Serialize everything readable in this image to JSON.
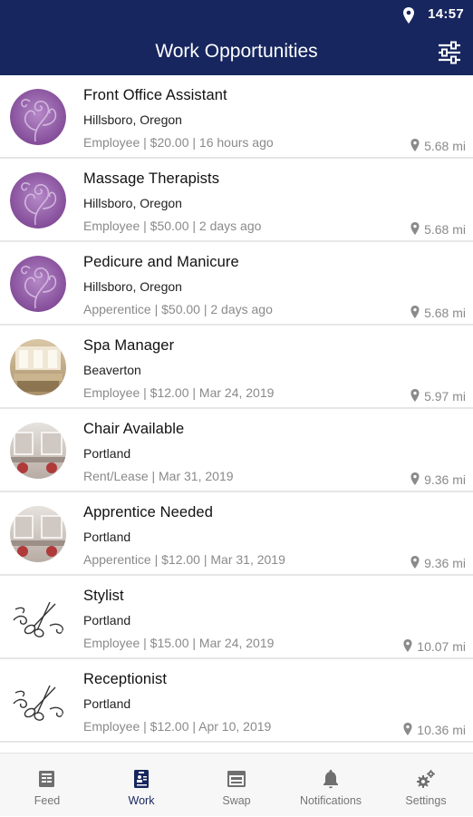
{
  "status_bar": {
    "time": "14:57",
    "location_icon": "location-pin-icon"
  },
  "header": {
    "title": "Work Opportunities",
    "filter_icon": "filter-sliders-icon"
  },
  "colors": {
    "primary": "#17265e",
    "muted": "#8a8a8a",
    "divider": "#e6e6e6",
    "purple_avatar": "#8f5aa6"
  },
  "jobs": [
    {
      "title": "Front Office Assistant",
      "location": "Hillsboro, Oregon",
      "meta": "Employee | $20.00 | 16 hours ago",
      "distance": "5.68 mi",
      "avatar": "purple-swirl"
    },
    {
      "title": "Massage Therapists",
      "location": "Hillsboro, Oregon",
      "meta": "Employee | $50.00 | 2 days ago",
      "distance": "5.68 mi",
      "avatar": "purple-swirl"
    },
    {
      "title": "Pedicure and Manicure",
      "location": "Hillsboro, Oregon",
      "meta": "Apperentice | $50.00 | 2 days ago",
      "distance": "5.68 mi",
      "avatar": "purple-swirl"
    },
    {
      "title": "Spa Manager",
      "location": "Beaverton",
      "meta": "Employee | $12.00 | Mar 24, 2019",
      "distance": "5.97 mi",
      "avatar": "spa-photo"
    },
    {
      "title": "Chair Available",
      "location": "Portland",
      "meta": "Rent/Lease | Mar 31, 2019",
      "distance": "9.36 mi",
      "avatar": "salon-photo"
    },
    {
      "title": "Apprentice Needed",
      "location": "Portland",
      "meta": "Apperentice | $12.00 | Mar 31, 2019",
      "distance": "9.36 mi",
      "avatar": "salon-photo"
    },
    {
      "title": "Stylist",
      "location": "Portland",
      "meta": "Employee | $15.00 | Mar 24, 2019",
      "distance": "10.07 mi",
      "avatar": "scissors-sketch"
    },
    {
      "title": "Receptionist",
      "location": "Portland",
      "meta": "Employee | $12.00 | Apr 10, 2019",
      "distance": "10.36 mi",
      "avatar": "scissors-sketch"
    }
  ],
  "bottom_nav": [
    {
      "label": "Feed",
      "icon": "feed-icon",
      "active": false
    },
    {
      "label": "Work",
      "icon": "work-badge-icon",
      "active": true
    },
    {
      "label": "Swap",
      "icon": "swap-icon",
      "active": false
    },
    {
      "label": "Notifications",
      "icon": "bell-icon",
      "active": false
    },
    {
      "label": "Settings",
      "icon": "gears-icon",
      "active": false
    }
  ]
}
